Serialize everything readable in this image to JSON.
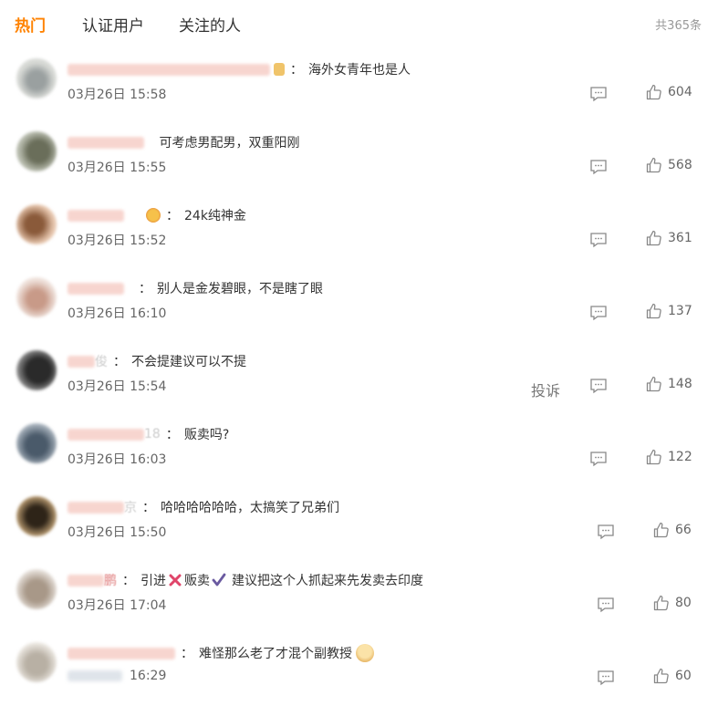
{
  "tabs": {
    "hot": "热门",
    "verified": "认证用户",
    "following": "关注的人"
  },
  "total": "共365条",
  "report_label": "投诉",
  "comments": [
    {
      "text": "海外女青年也是人",
      "time": "03月26日 15:58",
      "likes": "604"
    },
    {
      "text": "可考虑男配男，双重阳刚",
      "time": "03月26日 15:55",
      "likes": "568"
    },
    {
      "text": "24k纯神金",
      "time": "03月26日 15:52",
      "likes": "361"
    },
    {
      "text": "别人是金发碧眼，不是瞎了眼",
      "time": "03月26日 16:10",
      "likes": "137"
    },
    {
      "name_suffix": "俊",
      "text": "不会提建议可以不提",
      "time": "03月26日 15:54",
      "likes": "148"
    },
    {
      "name_suffix": "18",
      "text": "贩卖吗?",
      "time": "03月26日 16:03",
      "likes": "122"
    },
    {
      "name_suffix": "京",
      "text": "哈哈哈哈哈哈，太搞笑了兄弟们",
      "time": "03月26日 15:50",
      "likes": "66"
    },
    {
      "name_suffix": "鹏",
      "text_a": "引进",
      "text_b": "贩卖",
      "text_c": "建议把这个人抓起来先发卖去印度",
      "time": "03月26日 17:04",
      "likes": "80"
    },
    {
      "text": "难怪那么老了才混个副教授",
      "time": "16:29",
      "likes": "60"
    }
  ]
}
